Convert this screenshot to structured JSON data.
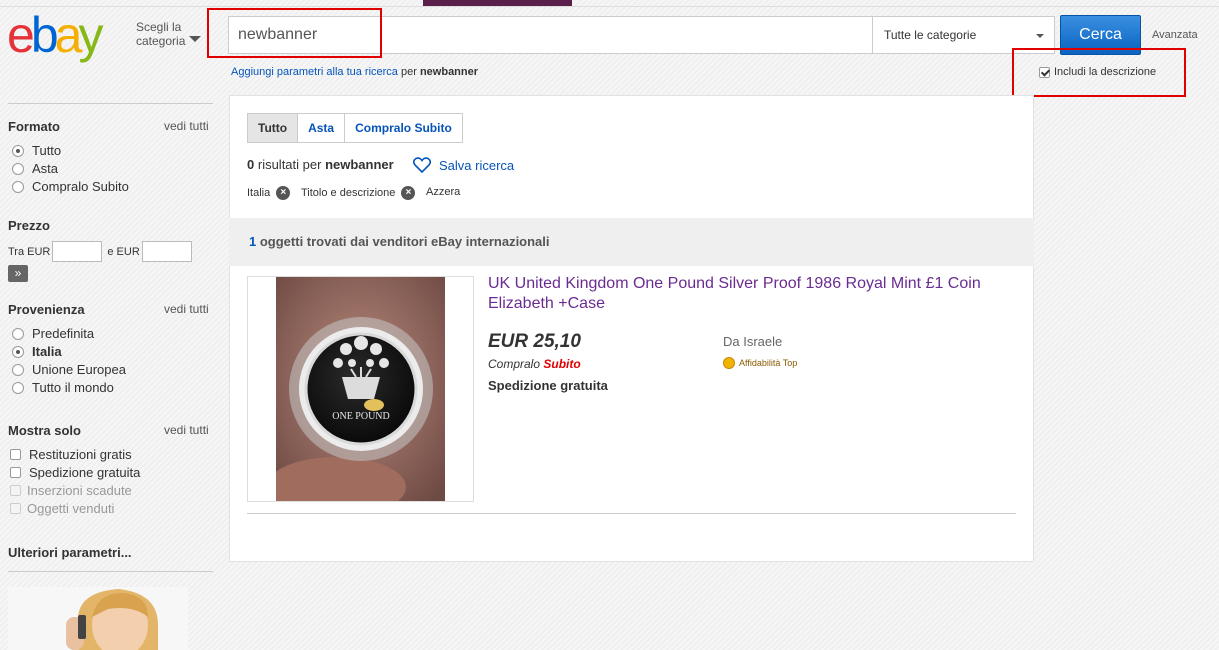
{
  "header": {
    "logo": {
      "e": "e",
      "b": "b",
      "a": "a",
      "y": "y"
    },
    "choose_category": "Scegli la categoria",
    "search_value": "newbanner",
    "category_select": "Tutte le categorie",
    "search_button": "Cerca",
    "advanced_link": "Avanzata",
    "add_params_link": "Aggiungi parametri alla tua ricerca",
    "add_params_for": "per",
    "add_params_term": "newbanner",
    "include_description": "Includi la descrizione",
    "include_description_checked": true
  },
  "sidebar": {
    "format": {
      "title": "Formato",
      "see_all": "vedi tutti",
      "options": [
        {
          "label": "Tutto",
          "selected": true
        },
        {
          "label": "Asta",
          "selected": false
        },
        {
          "label": "Compralo Subito",
          "selected": false
        }
      ]
    },
    "price": {
      "title": "Prezzo",
      "from_label": "Tra EUR",
      "to_label": "e EUR",
      "go_symbol": "»"
    },
    "origin": {
      "title": "Provenienza",
      "see_all": "vedi tutti",
      "options": [
        {
          "label": "Predefinita",
          "selected": false
        },
        {
          "label": "Italia",
          "selected": true
        },
        {
          "label": "Unione Europea",
          "selected": false
        },
        {
          "label": "Tutto il mondo",
          "selected": false
        }
      ]
    },
    "show_only": {
      "title": "Mostra solo",
      "see_all": "vedi tutti",
      "options": [
        {
          "label": "Restituzioni gratis",
          "enabled": true
        },
        {
          "label": "Spedizione gratuita",
          "enabled": true
        },
        {
          "label": "Inserzioni scadute",
          "enabled": false
        },
        {
          "label": "Oggetti venduti",
          "enabled": false
        }
      ]
    },
    "more_params": "Ulteriori parametri..."
  },
  "results": {
    "tabs": [
      "Tutto",
      "Asta",
      "Compralo Subito"
    ],
    "active_tab": "Tutto",
    "count": "0",
    "count_label": "risultati per",
    "query": "newbanner",
    "save_search": "Salva ricerca",
    "filters": [
      "Italia",
      "Titolo e descrizione"
    ],
    "clear_filters": "Azzera",
    "intl_count": "1",
    "intl_label": "oggetti trovati dai venditori eBay internazionali"
  },
  "item": {
    "title": "UK United Kingdom One Pound Silver Proof 1986 Royal Mint £1 Coin Elizabeth +Case",
    "price": "EUR 25,10",
    "buy_now_a": "Compralo",
    "buy_now_b": "Subito",
    "shipping": "Spedizione gratuita",
    "origin": "Da Israele",
    "top_rated": "Affidabilità Top",
    "coin_text": "ONE POUND"
  },
  "colors": {
    "link": "#0654ba",
    "item_title": "#6a2c91",
    "search_button": "#0e6fc9",
    "highlight": "#e00000"
  }
}
